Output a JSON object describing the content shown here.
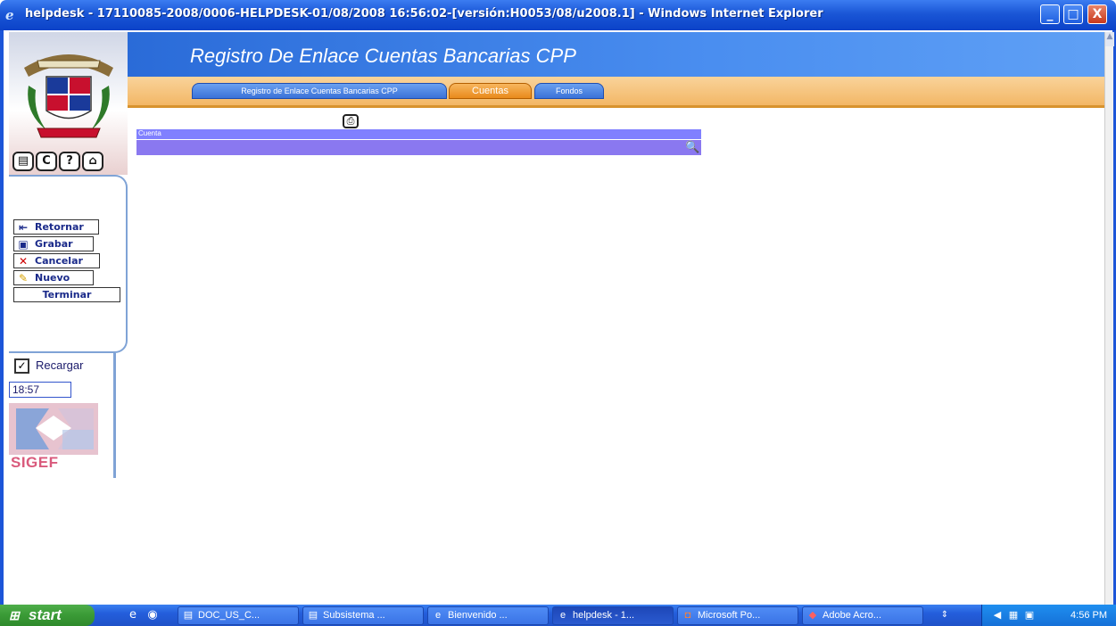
{
  "window": {
    "title": "helpdesk - 17110085-2008/0006-HELPDESK-01/08/2008 16:56:02-[versión:H0053/08/u2008.1] - Windows Internet Explorer",
    "minimize": "_",
    "maximize": "□",
    "close": "X"
  },
  "header": {
    "title": "Registro De Enlace Cuentas Bancarias CPP",
    "tabs": [
      {
        "label": "Registro de Enlace Cuentas Bancarias CPP"
      },
      {
        "label": "Cuentas"
      },
      {
        "label": "Fondos"
      }
    ]
  },
  "sidebar": {
    "top_icons": [
      "document-icon",
      "refresh-icon",
      "help-icon",
      "home-icon"
    ],
    "actions": [
      {
        "label": "Retornar",
        "icon": "back-arrow-icon"
      },
      {
        "label": "Grabar",
        "icon": "save-icon"
      },
      {
        "label": "Cancelar",
        "icon": "cancel-icon"
      },
      {
        "label": "Nuevo",
        "icon": "pencil-icon"
      },
      {
        "label": "Terminar"
      }
    ],
    "reload": {
      "label": "Recargar",
      "checked": true
    },
    "time": "18:57",
    "logo_text": "SIGEF"
  },
  "grid": {
    "column_header": "Cuenta"
  },
  "taskbar": {
    "start_label": "start",
    "buttons": [
      {
        "label": "DOC_US_C..."
      },
      {
        "label": "Subsistema ..."
      },
      {
        "label": "Bienvenido ..."
      },
      {
        "label": "helpdesk - 1..."
      },
      {
        "label": "Microsoft Po..."
      },
      {
        "label": "Adobe Acro..."
      }
    ],
    "clock": "4:56 PM"
  },
  "colors": {
    "title_bar": "#1a56d6",
    "banner_blue": "#4a8ef0",
    "banner_orange": "#f3b766",
    "grid_header": "#8080ff",
    "start_green": "#3a9a36"
  }
}
